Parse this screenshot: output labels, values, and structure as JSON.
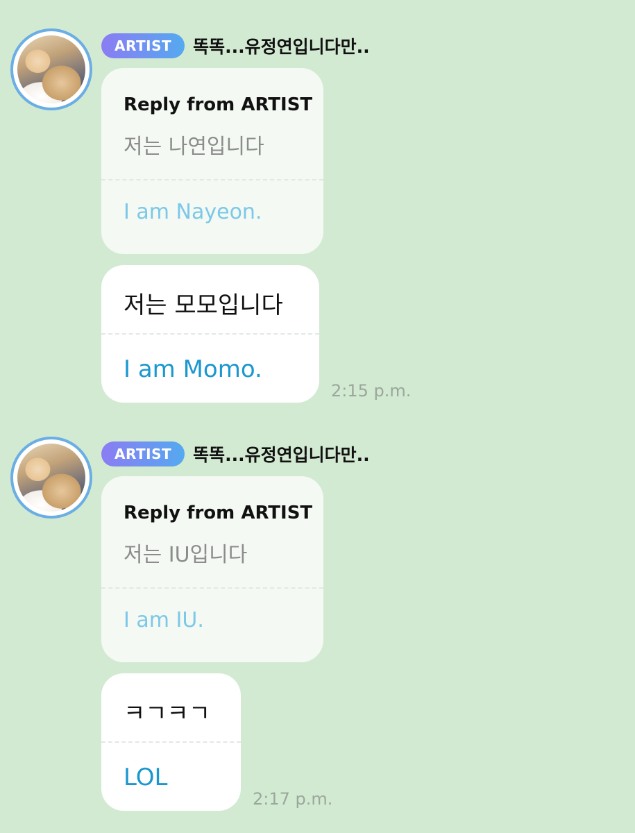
{
  "threads": [
    {
      "artist_badge": "ARTIST",
      "artist_name": "똑똑...유정연입니다만..",
      "reply_title": "Reply from ARTIST",
      "reply_korean": "저는 나연입니다",
      "reply_english": "I am Nayeon.",
      "message_korean": "저는 모모입니다",
      "message_english": "I am Momo.",
      "time": "2:15 p.m."
    },
    {
      "artist_badge": "ARTIST",
      "artist_name": "똑똑...유정연입니다만..",
      "reply_title": "Reply from ARTIST",
      "reply_korean": "저는 IU입니다",
      "reply_english": "I am IU.",
      "message_korean": "ㅋㄱㅋㄱ",
      "message_english": "LOL",
      "time": "2:17 p.m."
    }
  ]
}
